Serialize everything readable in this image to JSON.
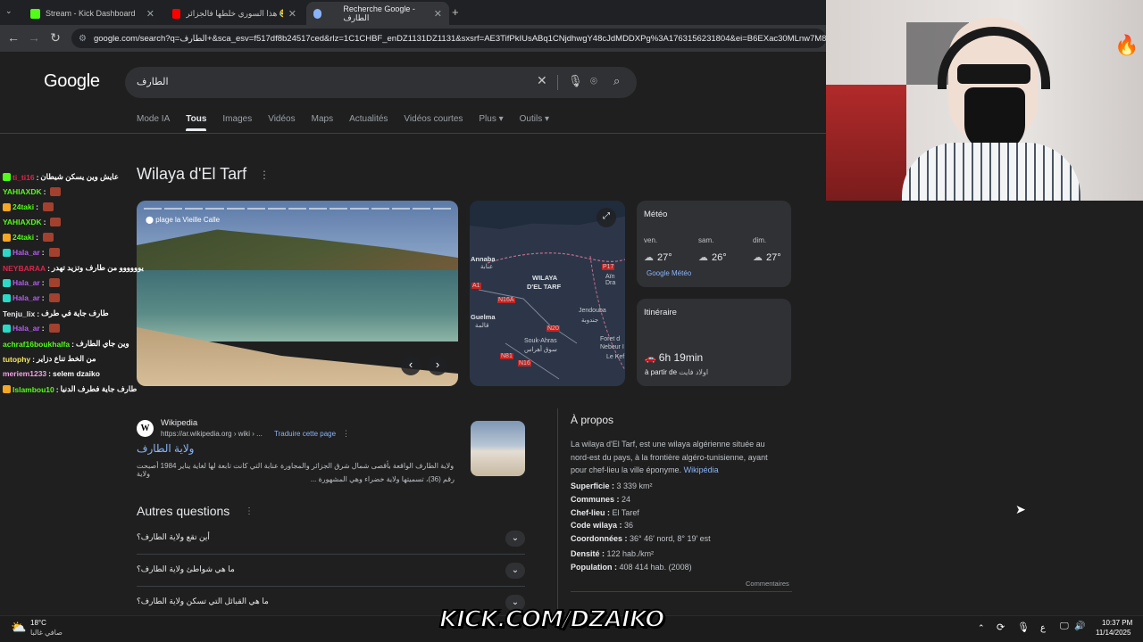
{
  "browser": {
    "tabs": [
      {
        "title": "Stream - Kick Dashboard",
        "close": "✕"
      },
      {
        "title": "هذا السوري خلطها فالجزائر 😂 - e",
        "close": "✕"
      },
      {
        "title": "Recherche Google - الطارف",
        "close": "✕"
      }
    ],
    "new_tab": "+",
    "url": "google.com/search?q=الطارف+&sca_esv=f517df8b24517ced&rlz=1C1CHBF_enDZ1131DZ1131&sxsrf=AE3TifPkIUsABq1CNjdhwgY48cJdMDDXPg%3A1763156231804&ei=B6EXac30MLnw7M8P3fvtuAc"
  },
  "google": {
    "logo": "Google",
    "query": "الطارف",
    "tabs": [
      "Mode IA",
      "Tous",
      "Images",
      "Vidéos",
      "Maps",
      "Actualités",
      "Vidéos courtes",
      "Plus ▾",
      "Outils ▾"
    ]
  },
  "knowledge_panel": {
    "title": "Wilaya d'El Tarf",
    "photo_caption": "plage la Vieille Calle",
    "map_labels": {
      "annaba": "Annaba",
      "annaba_ar": "عنابة",
      "region1": "WILAYA",
      "region2": "D'EL TARF",
      "guelma": "Guelma",
      "guelma_ar": "قالمة",
      "jendouba": "Jendouba",
      "jendouba_ar": "جندوبة",
      "souk_ahras": "Souk-Ahras",
      "souk_ahras_ar": "سوق أهراس",
      "ain_draham": "Aïn Dra",
      "foret": "Foret d",
      "nebeur": "Nebeur I",
      "le_kef": "Le Kef",
      "road_p17": "P17",
      "road_n16a": "N16A",
      "road_n20": "N20",
      "road_n81": "N81",
      "road_n16": "N16",
      "road_a1": "A1"
    },
    "weather": {
      "title": "Météo",
      "days": [
        {
          "day": "ven.",
          "temp": "27°"
        },
        {
          "day": "sam.",
          "temp": "26°"
        },
        {
          "day": "dim.",
          "temp": "27°"
        }
      ],
      "source": "Google Météo"
    },
    "itinerary": {
      "title": "Itinéraire",
      "duration": "6h 19min",
      "from_label": "à partir de",
      "from_place": "اولاد فايت"
    }
  },
  "result": {
    "source": "Wikipedia",
    "url": "https://ar.wikipedia.org › wiki › ...",
    "translate": "Traduire cette page",
    "title": "ولاية الطارف",
    "snippet_line1": "ولاية الطارف الواقعة بأقصى شمال شرق الجزائر والمجاورة عنابة التي كانت تابعة لها لغاية يناير 1984 أصبحت ولاية",
    "snippet_line2": "رقم (36)، تسميتها ولاية خضراء وهي المشهورة ..."
  },
  "questions": {
    "title": "Autres questions",
    "items": [
      "أين تقع ولاية الطارف؟",
      "ما هي شواطئ ولاية الطارف؟",
      "ما هي القبائل التي تسكن ولاية الطارف؟"
    ]
  },
  "about": {
    "title": "À propos",
    "text": "La wilaya d'El Tarf, est une wilaya algérienne située au nord-est du pays, à la frontière algéro-tunisienne, ayant pour chef-lieu la ville éponyme.",
    "link": "Wikipédia",
    "facts": [
      {
        "label": "Superficie :",
        "value": "3 339 km²"
      },
      {
        "label": "Communes :",
        "value": "24"
      },
      {
        "label": "Chef-lieu :",
        "value": "El Taref"
      },
      {
        "label": "Code wilaya :",
        "value": "36"
      },
      {
        "label": "Coordonnées :",
        "value": "36° 46′ nord, 8° 19′ est"
      },
      {
        "label": "Densité :",
        "value": "122 hab./km²"
      },
      {
        "label": "Population :",
        "value": "408 414 hab. (2008)"
      }
    ],
    "feedback": "Commentaires"
  },
  "chat": [
    {
      "user": "ti_ti16",
      "color": "#e0244a",
      "msg": "عايش وين يسكن شيطان",
      "badge": "#53fc18",
      "emote": false
    },
    {
      "user": "YAHIAXDK",
      "color": "#53fc18",
      "msg": "",
      "badge": "",
      "emote": true
    },
    {
      "user": "24taki",
      "color": "#53fc18",
      "msg": "",
      "badge": "#f5a623",
      "emote": true
    },
    {
      "user": "YAHIAXDK",
      "color": "#53fc18",
      "msg": "",
      "badge": "",
      "emote": true
    },
    {
      "user": "24taki",
      "color": "#53fc18",
      "msg": "",
      "badge": "#f5a623",
      "emote": true
    },
    {
      "user": "Hala_ar",
      "color": "#b65cf5",
      "msg": "",
      "badge": "#2bd9c7",
      "emote": true
    },
    {
      "user": "NEYBARAA",
      "color": "#e0244a",
      "msg": "يوووووو من طارف وتزيد تهدر",
      "badge": "",
      "emote": false
    },
    {
      "user": "Hala_ar",
      "color": "#b65cf5",
      "msg": "",
      "badge": "#2bd9c7",
      "emote": true
    },
    {
      "user": "Hala_ar",
      "color": "#b65cf5",
      "msg": "",
      "badge": "#2bd9c7",
      "emote": true
    },
    {
      "user": "Tenju_lix",
      "color": "#e8eaed",
      "msg": "طارف جاية في طرف",
      "badge": "",
      "emote": false
    },
    {
      "user": "Hala_ar",
      "color": "#b65cf5",
      "msg": "",
      "badge": "#2bd9c7",
      "emote": true
    },
    {
      "user": "achraf16boukhalfa",
      "color": "#53fc18",
      "msg": "وين جاي الطارف",
      "badge": "",
      "emote": false
    },
    {
      "user": "tutophy",
      "color": "#f5e663",
      "msg": "من الخط تناع دزاير",
      "badge": "",
      "emote": false
    },
    {
      "user": "meriem1233",
      "color": "#f5a0e6",
      "msg": "selem dzaiko",
      "badge": "",
      "emote": false
    },
    {
      "user": "Islambou10",
      "color": "#53fc18",
      "msg": "طارف جاية فطرف الدنيا",
      "badge": "#f5a623",
      "emote": false
    }
  ],
  "overlay": {
    "kick_text": "KICK.COM/DZAIKO"
  },
  "taskbar": {
    "temp": "18°C",
    "weather_desc": "صافي غالبا",
    "lang": "ع",
    "time": "10:37 PM",
    "date": "11/14/2025"
  }
}
